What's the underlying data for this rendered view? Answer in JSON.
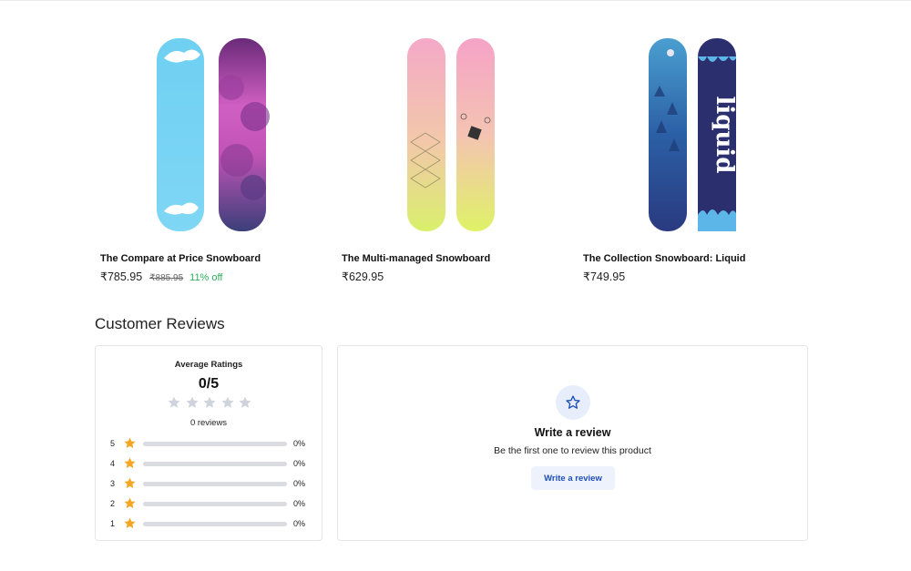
{
  "products": [
    {
      "name": "The Compare at Price Snowboard",
      "price": "₹785.95",
      "compare_price": "₹885.95",
      "discount": "11% off",
      "image_icon": "snowboard-blue-purple"
    },
    {
      "name": "The Multi-managed Snowboard",
      "price": "₹629.95",
      "compare_price": "",
      "discount": "",
      "image_icon": "snowboard-pastel"
    },
    {
      "name": "The Collection Snowboard: Liquid",
      "price": "₹749.95",
      "compare_price": "",
      "discount": "",
      "image_icon": "snowboard-liquid"
    }
  ],
  "reviews": {
    "title": "Customer Reviews",
    "average_label": "Average Ratings",
    "average_value": "0/5",
    "average_stars_filled": 0,
    "count_text": "0 reviews",
    "breakdown": [
      {
        "stars": "5",
        "percent": "0%",
        "fraction": 0
      },
      {
        "stars": "4",
        "percent": "0%",
        "fraction": 0
      },
      {
        "stars": "3",
        "percent": "0%",
        "fraction": 0
      },
      {
        "stars": "2",
        "percent": "0%",
        "fraction": 0
      },
      {
        "stars": "1",
        "percent": "0%",
        "fraction": 0
      }
    ],
    "write": {
      "icon": "star-outline-icon",
      "title": "Write a review",
      "subtitle": "Be the first one to review this product",
      "button_label": "Write a review"
    }
  },
  "colors": {
    "star_filled": "#f5a623",
    "star_empty": "#cfd3dc",
    "discount": "#2fae5b",
    "button_text": "#1d4fb8",
    "accent_blue": "#1d4fb8"
  },
  "currency_symbol": "₹"
}
